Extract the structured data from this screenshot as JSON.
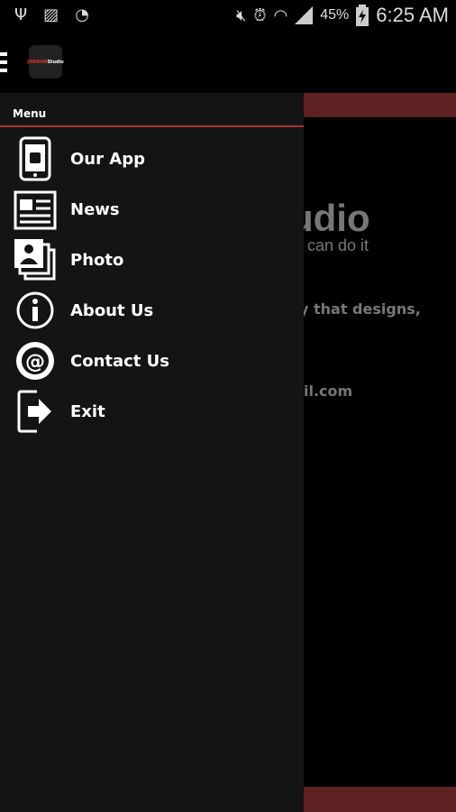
{
  "status_bar": {
    "battery": "45%",
    "time": "6:25 AM",
    "icons": [
      "usb-icon",
      "image-icon",
      "wifi-question-icon",
      "mute-icon",
      "alarm-icon",
      "wifi-icon",
      "signal-icon",
      "battery-charging-icon"
    ]
  },
  "app_bar": {
    "logo_text_red": "JORDAN",
    "logo_text_white": "Studio"
  },
  "background": {
    "title_fragment": "udio",
    "tagline_fragment": "can  do  it",
    "body_fragment": "y that designs,",
    "email_fragment": "il.com",
    "accent": "#5e2222"
  },
  "drawer": {
    "header": "Menu",
    "items": [
      {
        "label": "Our App",
        "icon": "android-phone-icon"
      },
      {
        "label": "News",
        "icon": "newspaper-icon"
      },
      {
        "label": "Photo",
        "icon": "photos-icon"
      },
      {
        "label": "About Us",
        "icon": "info-icon"
      },
      {
        "label": "Contact Us",
        "icon": "at-sign-icon"
      },
      {
        "label": "Exit",
        "icon": "exit-icon"
      }
    ]
  }
}
